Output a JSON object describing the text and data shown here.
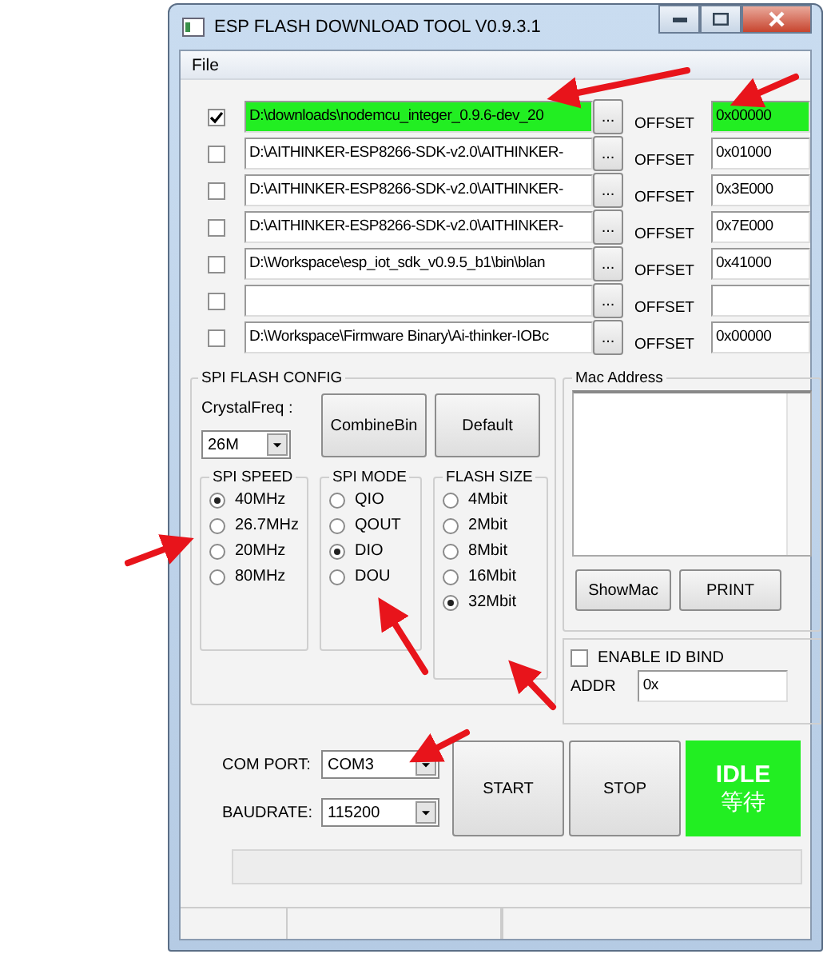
{
  "window": {
    "title": "ESP FLASH DOWNLOAD TOOL V0.9.3.1"
  },
  "menu": [
    "File"
  ],
  "files": [
    {
      "checked": true,
      "highlighted": true,
      "path": "D:\\downloads\\nodemcu_integer_0.9.6-dev_20",
      "browse": "...",
      "offset_label": "OFFSET",
      "offset": "0x00000"
    },
    {
      "checked": false,
      "highlighted": false,
      "path": "D:\\AITHINKER-ESP8266-SDK-v2.0\\AITHINKER-",
      "browse": "...",
      "offset_label": "OFFSET",
      "offset": "0x01000"
    },
    {
      "checked": false,
      "highlighted": false,
      "path": "D:\\AITHINKER-ESP8266-SDK-v2.0\\AITHINKER-",
      "browse": "...",
      "offset_label": "OFFSET",
      "offset": "0x3E000"
    },
    {
      "checked": false,
      "highlighted": false,
      "path": "D:\\AITHINKER-ESP8266-SDK-v2.0\\AITHINKER-",
      "browse": "...",
      "offset_label": "OFFSET",
      "offset": "0x7E000"
    },
    {
      "checked": false,
      "highlighted": false,
      "path": "D:\\Workspace\\esp_iot_sdk_v0.9.5_b1\\bin\\blan",
      "browse": "...",
      "offset_label": "OFFSET",
      "offset": "0x41000"
    },
    {
      "checked": false,
      "highlighted": false,
      "browse": "...",
      "offset_label": "OFFSET"
    },
    {
      "checked": false,
      "highlighted": false,
      "path": "D:\\Workspace\\Firmware Binary\\Ai-thinker-IOBc",
      "browse": "...",
      "offset_label": "OFFSET",
      "offset": "0x00000"
    }
  ],
  "spi_config": {
    "title": "SPI FLASH CONFIG",
    "crystal_label": "CrystalFreq :",
    "crystal": "26M",
    "buttons": [
      "CombineBin",
      "Default"
    ],
    "groups": [
      {
        "title": "SPI SPEED",
        "options": [
          {
            "label": "40MHz",
            "selected": true
          },
          {
            "label": "26.7MHz",
            "selected": false
          },
          {
            "label": "20MHz",
            "selected": false
          },
          {
            "label": "80MHz",
            "selected": false
          }
        ]
      },
      {
        "title": "SPI MODE",
        "options": [
          {
            "label": "QIO",
            "selected": false
          },
          {
            "label": "QOUT",
            "selected": false
          },
          {
            "label": "DIO",
            "selected": true
          },
          {
            "label": "DOU",
            "selected": false
          }
        ]
      },
      {
        "title": "FLASH SIZE",
        "options": [
          {
            "label": "4Mbit",
            "selected": false
          },
          {
            "label": "2Mbit",
            "selected": false
          },
          {
            "label": "8Mbit",
            "selected": false
          },
          {
            "label": "16Mbit",
            "selected": false
          },
          {
            "label": "32Mbit",
            "selected": true
          }
        ]
      }
    ]
  },
  "mac": {
    "title": "Mac Address",
    "buttons": [
      "ShowMac",
      "PRINT"
    ]
  },
  "id_bind": {
    "label": "ENABLE ID BIND",
    "checked": false,
    "addr_label": "ADDR",
    "addr": "0x"
  },
  "connection": {
    "com_label": "COM PORT:",
    "com": "COM3",
    "baud_label": "BAUDRATE:",
    "baud": "115200"
  },
  "actions": [
    "START",
    "STOP"
  ],
  "status": {
    "text": "IDLE",
    "subtext": "等待"
  }
}
